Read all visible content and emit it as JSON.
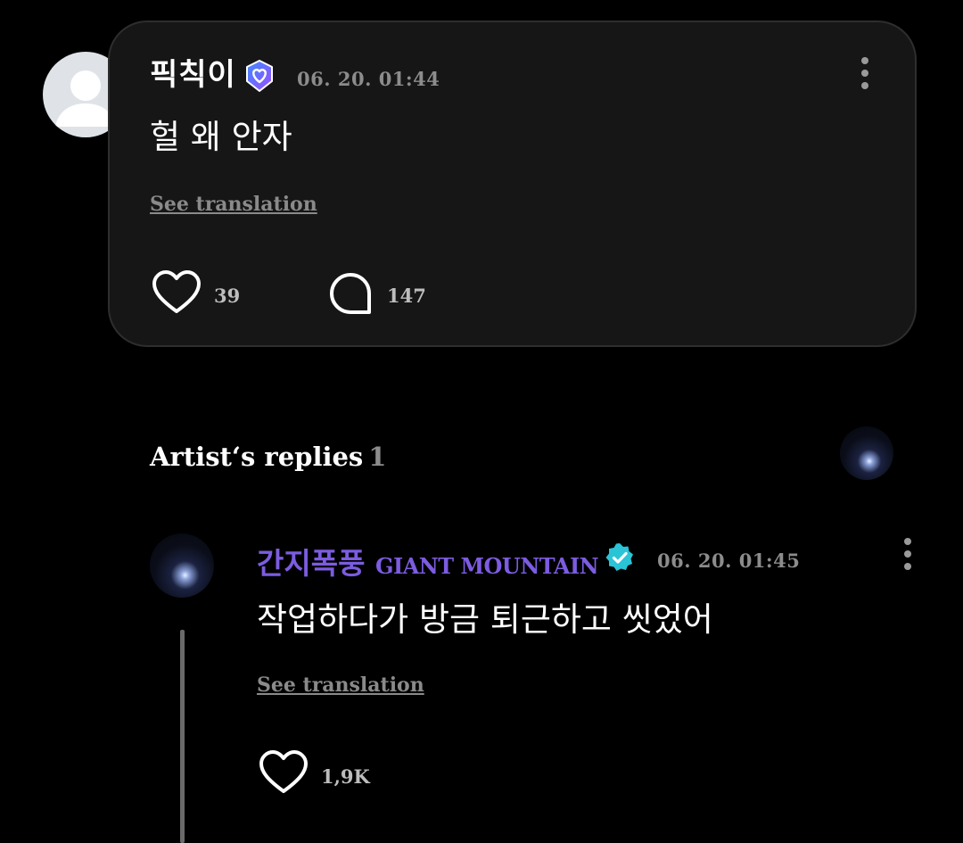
{
  "post": {
    "username": "픽칙이",
    "timestamp": "06. 20. 01:44",
    "body": "헐 왜 안자",
    "see_translation": "See translation",
    "like_count": "39",
    "comment_count": "147"
  },
  "artist_replies": {
    "title": "Artist‘s replies",
    "count": "1"
  },
  "reply": {
    "name_ko": "간지폭풍",
    "name_en": "GIANT MOUNTAIN",
    "timestamp": "06. 20. 01:45",
    "body": "작업하다가 방금 퇴근하고 씻었어",
    "see_translation": "See translation",
    "like_count": "1,9K"
  },
  "colors": {
    "background": "#000000",
    "card": "#161616",
    "artist_name": "#7c5ce0",
    "verified_badge": "#2ac4d6",
    "membership_badge": "#6a5cf0"
  },
  "icons": [
    "default-avatar-icon",
    "membership-badge-icon",
    "more-options-icon",
    "heart-icon",
    "comment-bubble-icon",
    "verified-badge-icon"
  ]
}
